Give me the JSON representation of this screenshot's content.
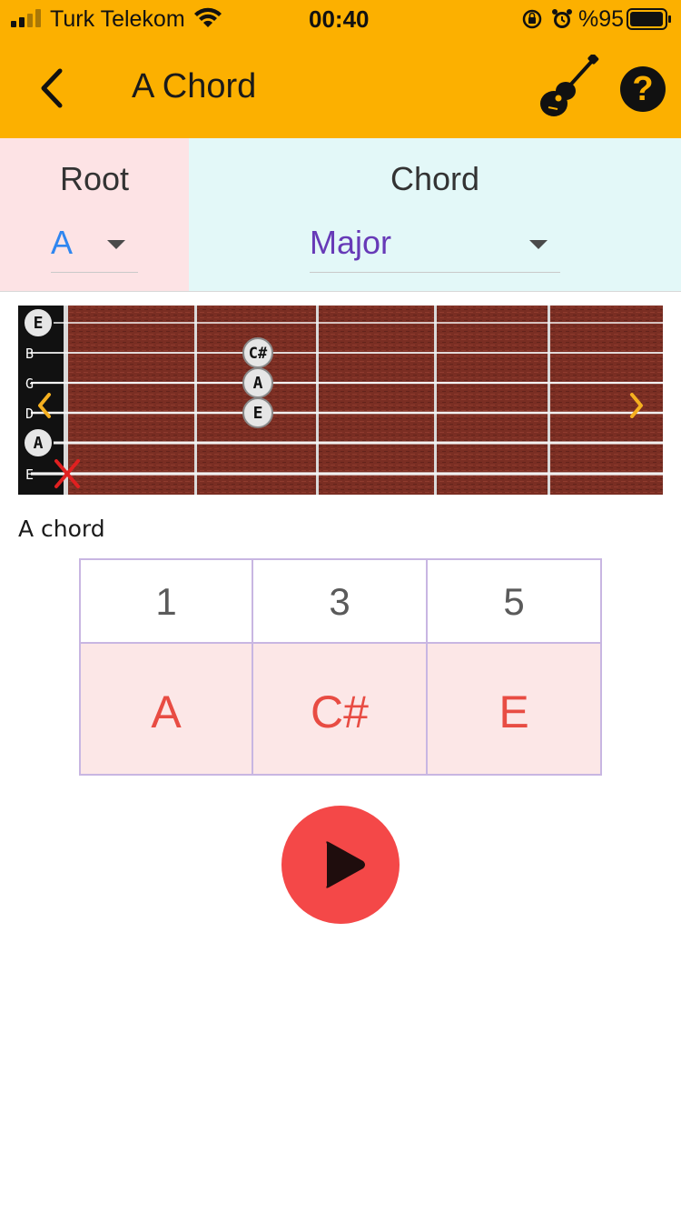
{
  "status_bar": {
    "carrier": "Turk Telekom",
    "time": "00:40",
    "battery_percent": "%95"
  },
  "header": {
    "title": "A Chord",
    "icons": [
      "back-chevron-icon",
      "guitar-icon",
      "help-icon"
    ],
    "help_glyph": "?"
  },
  "selectors": {
    "root": {
      "label": "Root",
      "value": "A"
    },
    "chord": {
      "label": "Chord",
      "value": "Major"
    }
  },
  "fretboard": {
    "string_names": [
      "E",
      "B",
      "G",
      "D",
      "A",
      "E"
    ],
    "markers": [
      {
        "string": 1,
        "fret": 0,
        "label": "E",
        "kind": "open"
      },
      {
        "string": 2,
        "fret": 2,
        "label": "C#",
        "kind": "fretted"
      },
      {
        "string": 3,
        "fret": 2,
        "label": "A",
        "kind": "fretted"
      },
      {
        "string": 4,
        "fret": 2,
        "label": "E",
        "kind": "fretted"
      },
      {
        "string": 5,
        "fret": 0,
        "label": "A",
        "kind": "open"
      },
      {
        "string": 6,
        "fret": 0,
        "label": "",
        "kind": "muted"
      }
    ],
    "nav_icons": [
      "chevron-left-icon",
      "chevron-right-icon"
    ],
    "caption": "A chord"
  },
  "chord_table": {
    "intervals": [
      "1",
      "3",
      "5"
    ],
    "notes": [
      "A",
      "C#",
      "E"
    ]
  },
  "colors": {
    "header_bg": "#fcb000",
    "root_panel_bg": "#fde3e5",
    "chord_panel_bg": "#e3f8f8",
    "root_value": "#2f86f0",
    "chord_value": "#673ab7",
    "note_text": "#e84c43",
    "note_row_bg": "#fce7e7",
    "play_button": "#f44848"
  }
}
